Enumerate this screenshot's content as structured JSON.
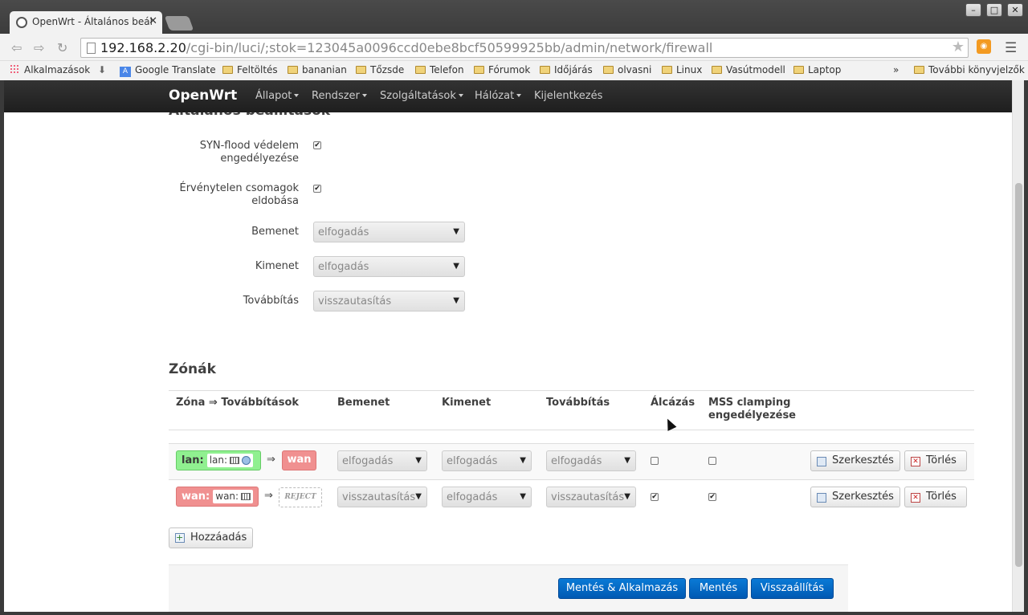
{
  "browser": {
    "tab_title": "OpenWrt - Általános beál",
    "url_host": "192.168.2.20",
    "url_path": "/cgi-bin/luci/;stok=123045a0096ccd0ebe8bcf50599925bb/admin/network/firewall",
    "bookmarks": [
      "Alkalmazások",
      "Google Translate",
      "Feltöltés",
      "bananian",
      "Tőzsde",
      "Telefon",
      "Fórumok",
      "Időjárás",
      "olvasni",
      "Linux",
      "Vasútmodell",
      "Laptop"
    ],
    "more_bookmarks_chevron": "»",
    "other_bookmarks": "További könyvjelzők",
    "accent_rss": "#f39a21"
  },
  "navbar": {
    "brand": "OpenWrt",
    "items": [
      "Állapot",
      "Rendszer",
      "Szolgáltatások",
      "Hálózat",
      "Kijelentkezés"
    ]
  },
  "general": {
    "section_title": "Általános beállítások",
    "syn_label": "SYN-flood védelem engedélyezése",
    "syn_checked": true,
    "invalid_label": "Érvénytelen csomagok eldobása",
    "invalid_checked": true,
    "input_label": "Bemenet",
    "input_value": "elfogadás",
    "output_label": "Kimenet",
    "output_value": "elfogadás",
    "forward_label": "Továbbítás",
    "forward_value": "visszautasítás"
  },
  "zones": {
    "title": "Zónák",
    "headers": [
      "Zóna ⇒ Továbbítások",
      "Bemenet",
      "Kimenet",
      "Továbbítás",
      "Álcázás",
      "MSS clamping engedélyezése"
    ],
    "rows": [
      {
        "zone": "lan:",
        "inner": "lan:",
        "color": "#90f090",
        "arrow": "⇒",
        "target": "wan",
        "target_color": "#f09090",
        "input": "elfogadás",
        "output": "elfogadás",
        "forward": "elfogadás",
        "masq": false,
        "mss": false,
        "edit": "Szerkesztés",
        "delete": "Törlés"
      },
      {
        "zone": "wan:",
        "inner": "wan:",
        "color": "#f09090",
        "arrow": "⇒",
        "target": "REJECT",
        "input": "visszautasítás",
        "output": "elfogadás",
        "forward": "visszautasítás",
        "masq": true,
        "mss": true,
        "edit": "Szerkesztés",
        "delete": "Törlés"
      }
    ],
    "add_button": "Hozzáadás"
  },
  "footer": {
    "save_apply": "Mentés & Alkalmazás",
    "save": "Mentés",
    "reset": "Visszaállítás",
    "primary_color": "#0069d6"
  }
}
